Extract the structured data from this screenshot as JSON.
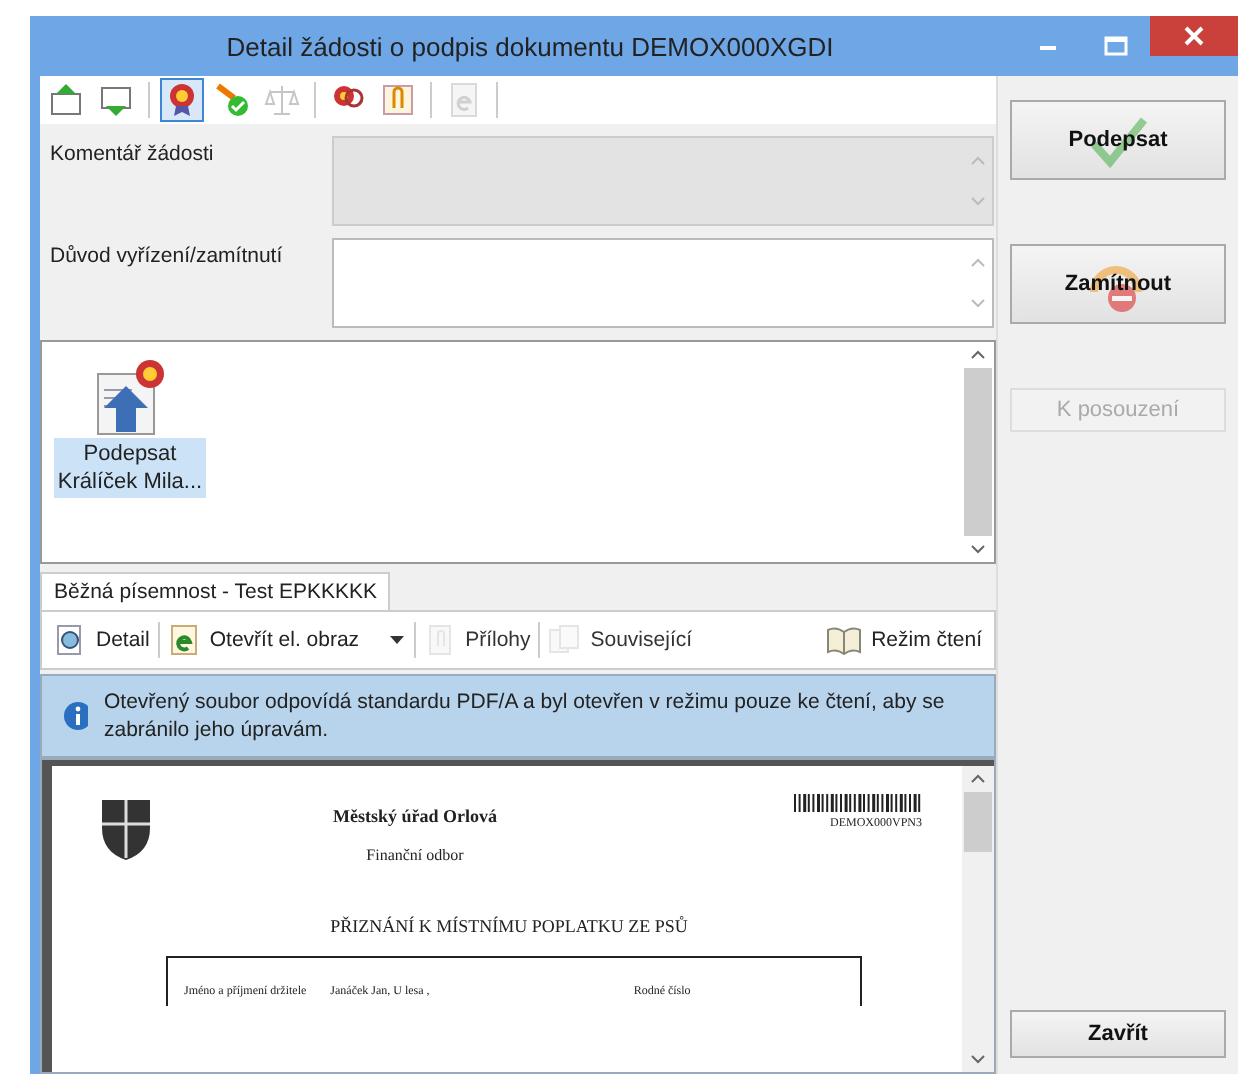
{
  "window": {
    "title": "Detail žádosti o podpis dokumentu DEMOX000XGDI"
  },
  "toolbar": [
    {
      "kind": "addup",
      "selected": false,
      "disabled": false
    },
    {
      "kind": "adddown",
      "selected": false,
      "disabled": false
    },
    {
      "kind": "seal",
      "selected": true,
      "disabled": false
    },
    {
      "kind": "signok",
      "selected": false,
      "disabled": false
    },
    {
      "kind": "scale",
      "selected": false,
      "disabled": true
    },
    {
      "kind": "sealsearch",
      "selected": false,
      "disabled": false
    },
    {
      "kind": "clip",
      "selected": false,
      "disabled": false
    },
    {
      "kind": "edoc",
      "selected": false,
      "disabled": true
    }
  ],
  "fields": [
    {
      "label": "Komentář žádosti",
      "disabled": true
    },
    {
      "label": "Důvod vyřízení/zamítnutí",
      "disabled": false
    }
  ],
  "attachments": [
    {
      "title": "Podepsat",
      "subtitle": "Králíček Mila...",
      "selected": true
    }
  ],
  "tabs": [
    {
      "label": "Běžná písemnost - Test EPKKKKK",
      "selected": true
    }
  ],
  "doc_toolbar": [
    {
      "kind": "detail",
      "label": "Detail",
      "disabled": false
    },
    {
      "kind": "open",
      "label": "Otevřít el. obraz",
      "disabled": false
    },
    {
      "kind": "attach",
      "label": "Přílohy",
      "disabled": true
    },
    {
      "kind": "related",
      "label": "Související",
      "disabled": true
    },
    {
      "kind": "read",
      "label": "Režim čtení",
      "disabled": false
    }
  ],
  "info_message": "Otevřený soubor odpovídá standardu PDF/A a byl otevřen v režimu pouze ke čtení, aby se zabránilo jeho úpravám.",
  "document": {
    "office": "Městský úřad Orlová",
    "department": "Finanční odbor",
    "barcode_id": "DEMOX000VPN3",
    "heading": "PŘIZNÁNÍ K MÍSTNÍMU POPLATKU ZE PSŮ",
    "row": [
      "Jméno a příjmení držitele",
      "Janáček Jan, U lesa ,",
      "Rodné číslo"
    ]
  },
  "side_buttons": [
    {
      "kind": "sign",
      "label": "Podepsat",
      "disabled": false
    },
    {
      "kind": "reject",
      "label": "Zamítnout",
      "disabled": false
    },
    {
      "kind": "plain",
      "label": "K posouzení",
      "disabled": true
    }
  ],
  "close_button": "Zavřít"
}
